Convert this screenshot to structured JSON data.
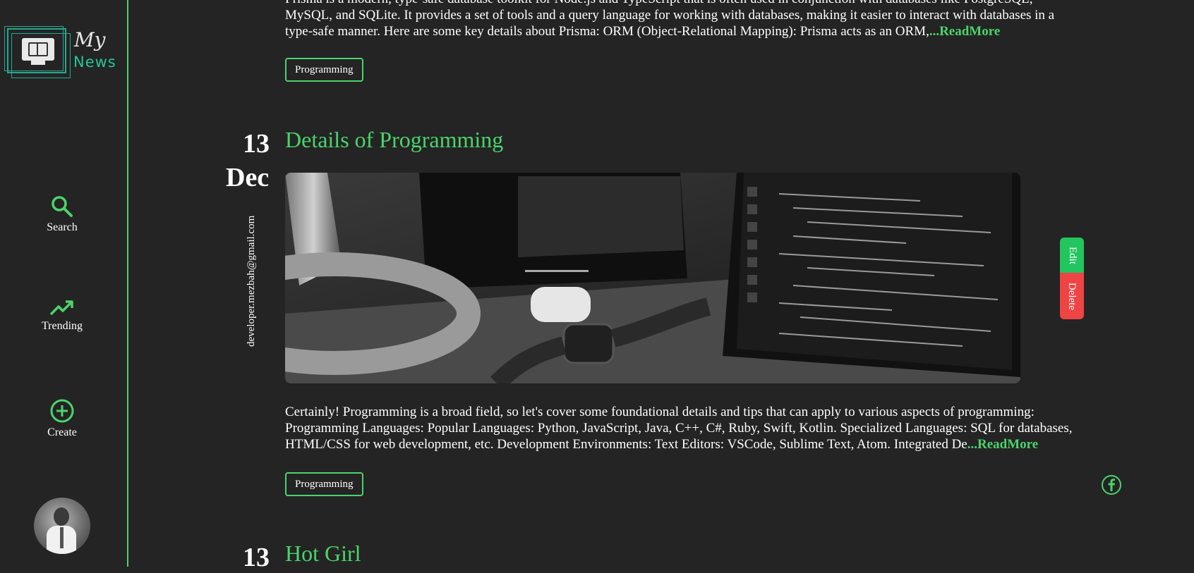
{
  "app": {
    "logo_top": "My",
    "logo_bottom": "News"
  },
  "sidebar": {
    "items": [
      {
        "label": "Search",
        "icon": "search-icon"
      },
      {
        "label": "Trending",
        "icon": "trending-icon"
      },
      {
        "label": "Create",
        "icon": "plus-circle-icon"
      }
    ]
  },
  "colors": {
    "accent": "#4ad46b",
    "background": "#242424",
    "edit": "#22c55e",
    "delete": "#ef4444"
  },
  "posts": [
    {
      "excerpt_line0": "Prisma is a modern, type-safe database toolkit for Node.js and TypeScript that is often used in conjunction with databases like PostgreSQL,",
      "excerpt_line1": "MySQL, and SQLite. It provides a set of tools and a query language for working with databases, making it easier to interact with databases in a",
      "excerpt_line2": "type-safe manner. Here are some key details about Prisma: ORM (Object-Relational Mapping): Prisma acts as an ORM,",
      "readmore": "...ReadMore",
      "tag": "Programming"
    },
    {
      "day": "13",
      "month": "Dec",
      "author_email": "developer.mezbah@gmail.com",
      "title": "Details of Programming",
      "excerpt_line1": "Certainly! Programming is a broad field, so let's cover some foundational details and tips that can apply to various aspects of programming:",
      "excerpt_line2": "Programming Languages: Popular Languages: Python, JavaScript, Java, C++, C#, Ruby, Swift, Kotlin. Specialized Languages: SQL for databases,",
      "excerpt_line3": "HTML/CSS for web development, etc. Development Environments: Text Editors: VSCode, Sublime Text, Atom. Integrated De",
      "readmore": "...ReadMore",
      "tag": "Programming",
      "edit_label": "Edit",
      "delete_label": "Delete",
      "share_icon": "facebook-icon"
    },
    {
      "day": "13",
      "title": "Hot Girl"
    }
  ]
}
